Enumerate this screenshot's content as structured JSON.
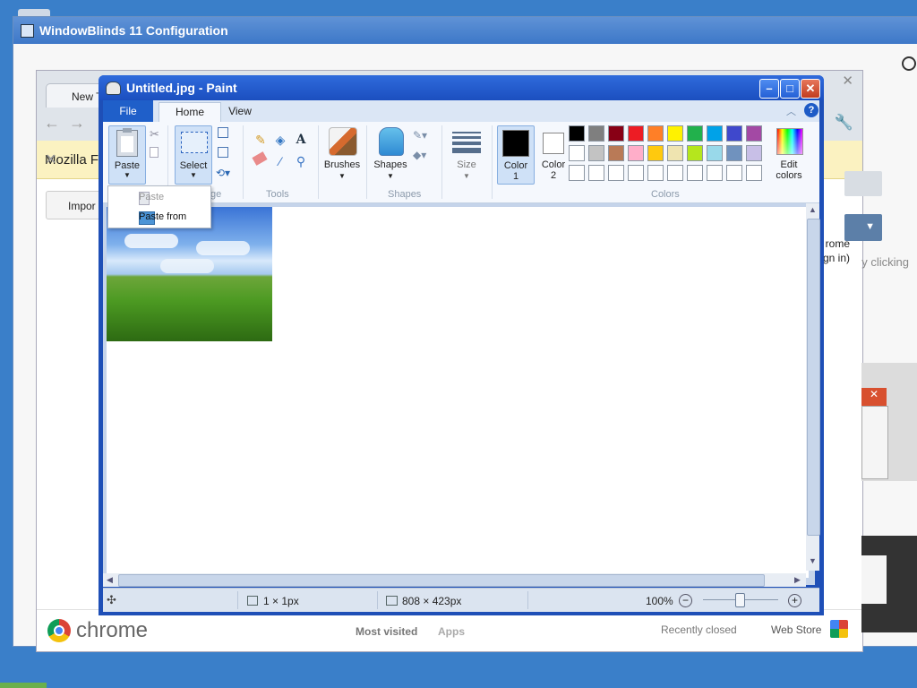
{
  "windowblinds": {
    "title": "WindowBlinds 11 Configuration"
  },
  "chrome": {
    "tab_label": "New T",
    "infobar_text": "Mozilla Fi",
    "import_label": "Impor",
    "signin_a": "rome",
    "signin_b": "gn in)",
    "click_text": "y clicking",
    "logo_word": "chrome",
    "most_visited": "Most visited",
    "apps": "Apps",
    "recently_closed": "Recently closed",
    "web_store": "Web Store"
  },
  "paint": {
    "title": "Untitled.jpg - Paint",
    "tabs": {
      "file": "File",
      "home": "Home",
      "view": "View"
    },
    "ribbon": {
      "paste": "Paste",
      "select": "Select",
      "image_group": "ge",
      "tools_group": "Tools",
      "brushes": "Brushes",
      "shapes": "Shapes",
      "shapes_group": "Shapes",
      "size": "Size",
      "color1_a": "Color",
      "color1_b": "1",
      "color2_a": "Color",
      "color2_b": "2",
      "colors_group": "Colors",
      "edit_colors_a": "Edit",
      "edit_colors_b": "colors"
    },
    "palette_row1": [
      "#000000",
      "#7f7f7f",
      "#880015",
      "#ed1c24",
      "#ff7f27",
      "#fff200",
      "#22b14c",
      "#00a2e8",
      "#3f48cc",
      "#a349a4"
    ],
    "palette_row2": [
      "#ffffff",
      "#c3c3c3",
      "#b97a57",
      "#ffaec9",
      "#ffc90e",
      "#efe4b0",
      "#b5e61d",
      "#99d9ea",
      "#7092be",
      "#c8bfe7"
    ],
    "palette_row3": [
      "#ffffff",
      "#ffffff",
      "#ffffff",
      "#ffffff",
      "#ffffff",
      "#ffffff",
      "#ffffff",
      "#ffffff",
      "#ffffff",
      "#ffffff"
    ],
    "paste_menu": {
      "paste": "Paste",
      "paste_from": "Paste from"
    },
    "status": {
      "selection": "1 × 1px",
      "image_size": "808 × 423px",
      "zoom": "100%"
    }
  }
}
